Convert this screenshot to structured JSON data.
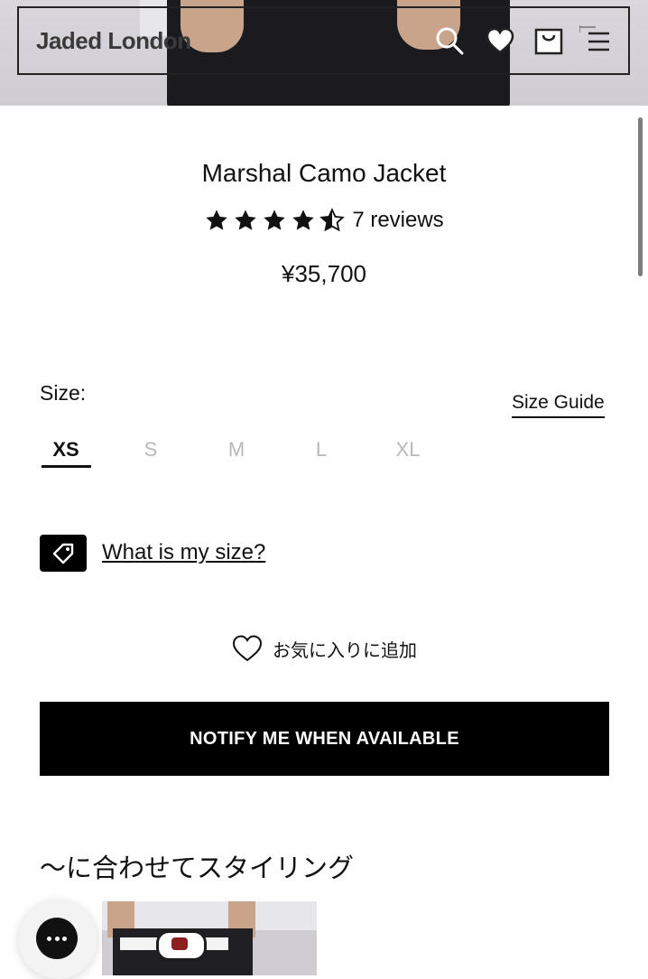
{
  "header": {
    "brand": "Jaded London",
    "icons": [
      "search-icon",
      "heart-icon",
      "bag-icon",
      "menu-icon"
    ]
  },
  "product": {
    "title": "Marshal Camo Jacket",
    "rating": 4.5,
    "stars_max": 5,
    "reviews": "7 reviews",
    "price": "¥35,700"
  },
  "size": {
    "label": "Size:",
    "guide_label": "Size Guide",
    "options": [
      "XS",
      "S",
      "M",
      "L",
      "XL"
    ],
    "selected": "XS",
    "help_label": "What is my size?"
  },
  "wishlist": {
    "label": "お気に入りに追加"
  },
  "cta": {
    "notify_label": "NOTIFY ME WHEN AVAILABLE"
  },
  "styling": {
    "heading": "〜に合わせてスタイリング"
  },
  "colors": {
    "primary": "#000000",
    "muted_size": "#b8b8b8",
    "hero_bg": "#d9d7dd"
  }
}
